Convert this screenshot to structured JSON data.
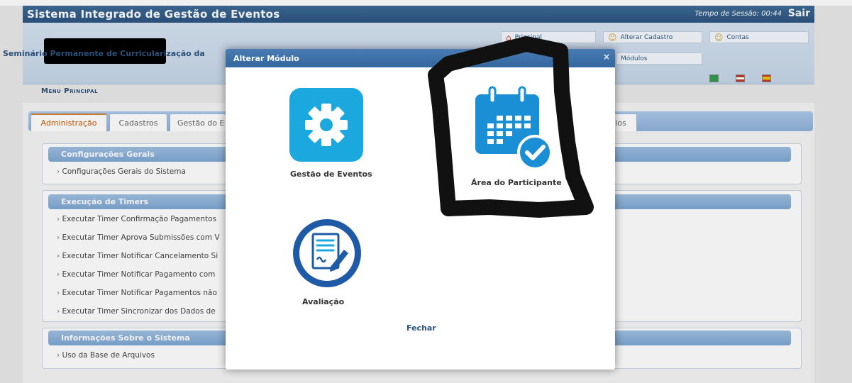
{
  "header": {
    "system_title": "Sistema Integrado de Gestão de Eventos",
    "session_time": "Tempo de Sessão: 00:44",
    "logout": "Sair",
    "event_title": "Seminário Permanente de Curricularização da",
    "links": {
      "principal": "Principal",
      "alterar_cadastro": "Alterar Cadastro",
      "contas": "Contas",
      "modulos": "Módulos"
    }
  },
  "menu_label": "Menu Principal",
  "tabs": [
    "Administração",
    "Cadastros",
    "Gestão do E",
    "ios"
  ],
  "panels": {
    "configuracoes": {
      "title": "Configurações Gerais",
      "items": [
        "Configurações Gerais do Sistema"
      ]
    },
    "timers": {
      "title": "Execução de Timers",
      "items": [
        "Executar Timer Confirmação Pagamentos",
        "Executar Timer Aprova Submissões com V",
        "Executar Timer Notificar Cancelamento Si",
        "Executar Timer Notificar Pagamento com",
        "Executar Timer Notificar Pagamentos não",
        "Executar Timer Sincronizar dos Dados de"
      ]
    },
    "info": {
      "title": "Informações Sobre o Sistema",
      "items": [
        "Uso da Base de Arquivos"
      ]
    }
  },
  "modal": {
    "title": "Alterar Módulo",
    "close_icon": "×",
    "modules": [
      {
        "label": "Gestão de Eventos",
        "icon": "gear-icon"
      },
      {
        "label": "Área do Participante",
        "icon": "calendar-check-icon"
      },
      {
        "label": "Avaliação",
        "icon": "document-edit-icon"
      }
    ],
    "close_label": "Fechar"
  },
  "colors": {
    "title_bar": "#2d5581",
    "accent_orange": "#c95a00",
    "module_blue": "#1aa8df",
    "modal_header": "#3a6ea8"
  }
}
